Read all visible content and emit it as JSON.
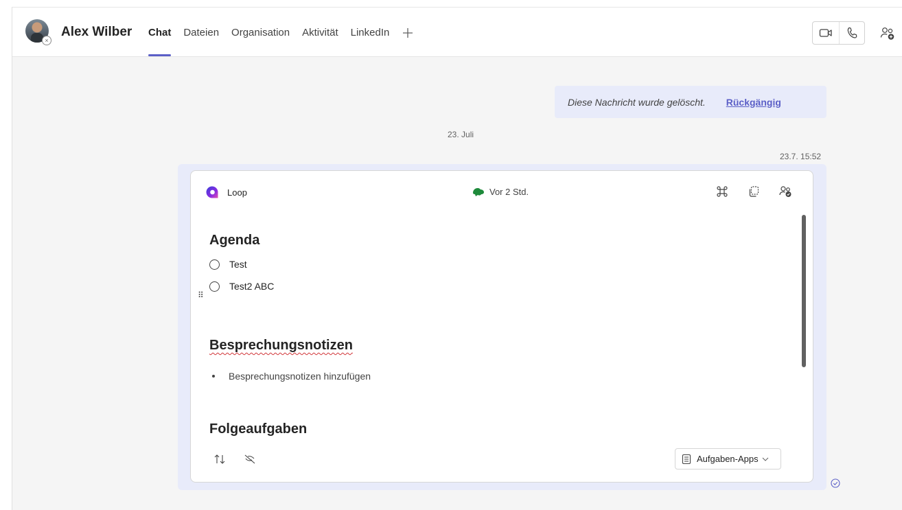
{
  "header": {
    "contact_name": "Alex Wilber",
    "tabs": [
      {
        "label": "Chat",
        "active": true
      },
      {
        "label": "Dateien"
      },
      {
        "label": "Organisation"
      },
      {
        "label": "Aktivität"
      },
      {
        "label": "LinkedIn"
      }
    ],
    "add_tab_icon": "plus-icon",
    "icons": {
      "video": "video-call-icon",
      "phone": "phone-icon",
      "people": "add-people-icon"
    }
  },
  "chat": {
    "deleted_message": {
      "text": "Diese Nachricht wurde gelöscht.",
      "undo_label": "Rückgängig"
    },
    "date_separator": "23. Juli",
    "message_timestamp": "23.7. 15:52"
  },
  "loop_card": {
    "app_name": "Loop",
    "activity_text": "Vor 2 Std.",
    "sections": {
      "agenda": {
        "heading": "Agenda",
        "items": [
          "Test",
          "Test2 ABC"
        ]
      },
      "notes": {
        "heading": "Besprechungsnotizen",
        "bullet": "Besprechungsnotizen hinzufügen"
      },
      "followups": {
        "heading": "Folgeaufgaben",
        "task_apps_label": "Aufgaben-Apps"
      }
    }
  },
  "colors": {
    "accent": "#5b5fc7",
    "bubble": "#e8ebfa",
    "spellcheck": "#d13438"
  }
}
